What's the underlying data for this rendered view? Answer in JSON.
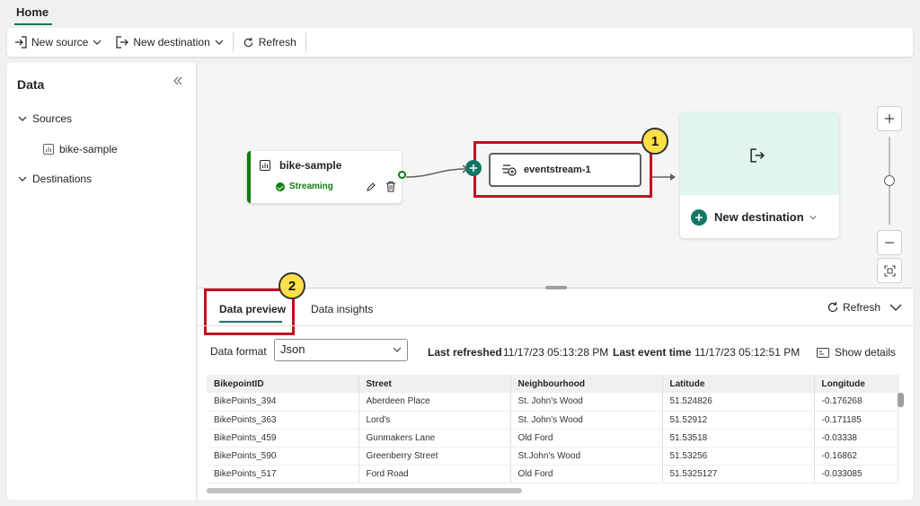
{
  "tabbar": {
    "home_label": "Home"
  },
  "toolbar": {
    "new_source_label": "New source",
    "new_destination_label": "New destination",
    "refresh_label": "Refresh"
  },
  "left_panel": {
    "title": "Data",
    "sources_label": "Sources",
    "source_item": "bike-sample",
    "destinations_label": "Destinations"
  },
  "canvas": {
    "source_node": {
      "title": "bike-sample",
      "status": "Streaming"
    },
    "stream_node": {
      "label": "eventstream-1",
      "badge": "1"
    },
    "destination_node": {
      "label": "New destination"
    },
    "zoom_level": 0.5
  },
  "bottom_panel": {
    "tabs": [
      {
        "label": "Data preview",
        "active": true
      },
      {
        "label": "Data insights",
        "active": false
      }
    ],
    "badge": "2",
    "refresh_label": "Refresh",
    "data_format_label": "Data format",
    "data_format_value": "Json",
    "last_refreshed_label": "Last refreshed",
    "last_refreshed_value": "11/17/23 05:13:28 PM",
    "last_event_label": "Last event time",
    "last_event_value": "11/17/23 05:12:51 PM",
    "show_details_label": "Show details"
  },
  "table": {
    "columns": [
      "BikepointID",
      "Street",
      "Neighbourhood",
      "Latitude",
      "Longitude"
    ],
    "rows": [
      [
        "BikePoints_394",
        "Aberdeen Place",
        "St. John's Wood",
        "51.524826",
        "-0.176268"
      ],
      [
        "BikePoints_363",
        "Lord's",
        "St. John's Wood",
        "51.52912",
        "-0.171185"
      ],
      [
        "BikePoints_459",
        "Gunmakers Lane",
        "Old Ford",
        "51.53518",
        "-0.03338"
      ],
      [
        "BikePoints_590",
        "Greenberry Street",
        "St.John's Wood",
        "51.53256",
        "-0.16862"
      ],
      [
        "BikePoints_517",
        "Ford Road",
        "Old Ford",
        "51.5325127",
        "-0.033085"
      ]
    ]
  },
  "colors": {
    "accent": "#117865",
    "streaming_green": "#107c10",
    "highlight_red": "#c50f1f",
    "badge_yellow": "#fde047",
    "destination_bg": "#e0f5ec"
  }
}
